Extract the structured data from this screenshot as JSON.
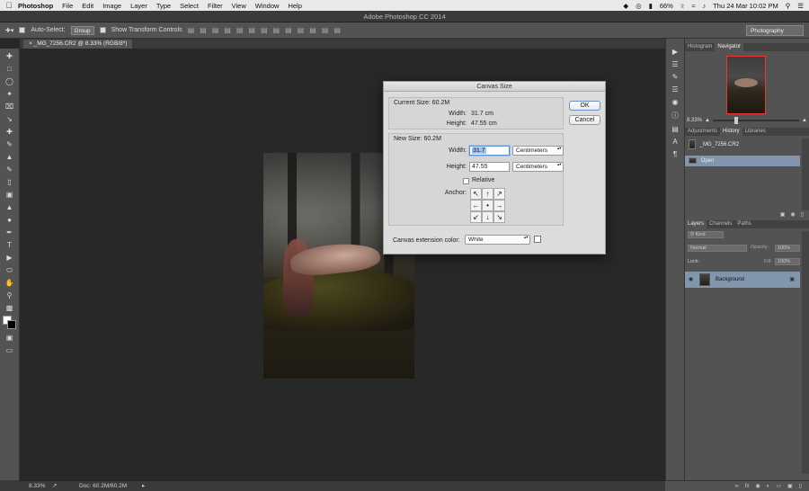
{
  "menubar": {
    "app": "Photoshop",
    "items": [
      "File",
      "Edit",
      "Image",
      "Layer",
      "Type",
      "Select",
      "Filter",
      "View",
      "Window",
      "Help"
    ],
    "battery": "66%",
    "clock": "Thu 24 Mar  10:02 PM"
  },
  "window": {
    "title": "Adobe Photoshop CC 2014"
  },
  "options": {
    "auto_select_label": "Auto-Select:",
    "auto_select_value": "Group",
    "transform_label": "Show Transform Controls",
    "workspace": "Photography"
  },
  "document": {
    "tab": "_MG_7256.CR2 @ 8.33% (RGB/8*)"
  },
  "dialog": {
    "title": "Canvas Size",
    "current": {
      "legend": "Current Size: 60.2M",
      "width_label": "Width:",
      "width_value": "31.7 cm",
      "height_label": "Height:",
      "height_value": "47.55 cm"
    },
    "new": {
      "legend": "New Size: 60.2M",
      "width_label": "Width:",
      "width_value": "31.7",
      "height_label": "Height:",
      "height_value": "47.55",
      "width_unit": "Centimeters",
      "height_unit": "Centimeters",
      "relative_label": "Relative",
      "anchor_label": "Anchor:"
    },
    "extension_label": "Canvas extension color:",
    "extension_value": "White",
    "ok": "OK",
    "cancel": "Cancel"
  },
  "navigator": {
    "tabs": [
      "Histogram",
      "Navigator"
    ],
    "zoom": "8.33%"
  },
  "history": {
    "tabs": [
      "Adjustments",
      "History",
      "Libraries"
    ],
    "snapshot": "_MG_7256.CR2",
    "items": [
      "Open"
    ]
  },
  "layers": {
    "tabs": [
      "Layers",
      "Channels",
      "Paths"
    ],
    "kind": "Kind",
    "blend": "Normal",
    "opacity_label": "Opacity:",
    "opacity_value": "100%",
    "lock_label": "Lock:",
    "fill_label": "Fill:",
    "fill_value": "100%",
    "layer_name": "Background"
  },
  "status": {
    "zoom": "8.33%",
    "doc": "Doc: 60.2M/60.2M"
  }
}
